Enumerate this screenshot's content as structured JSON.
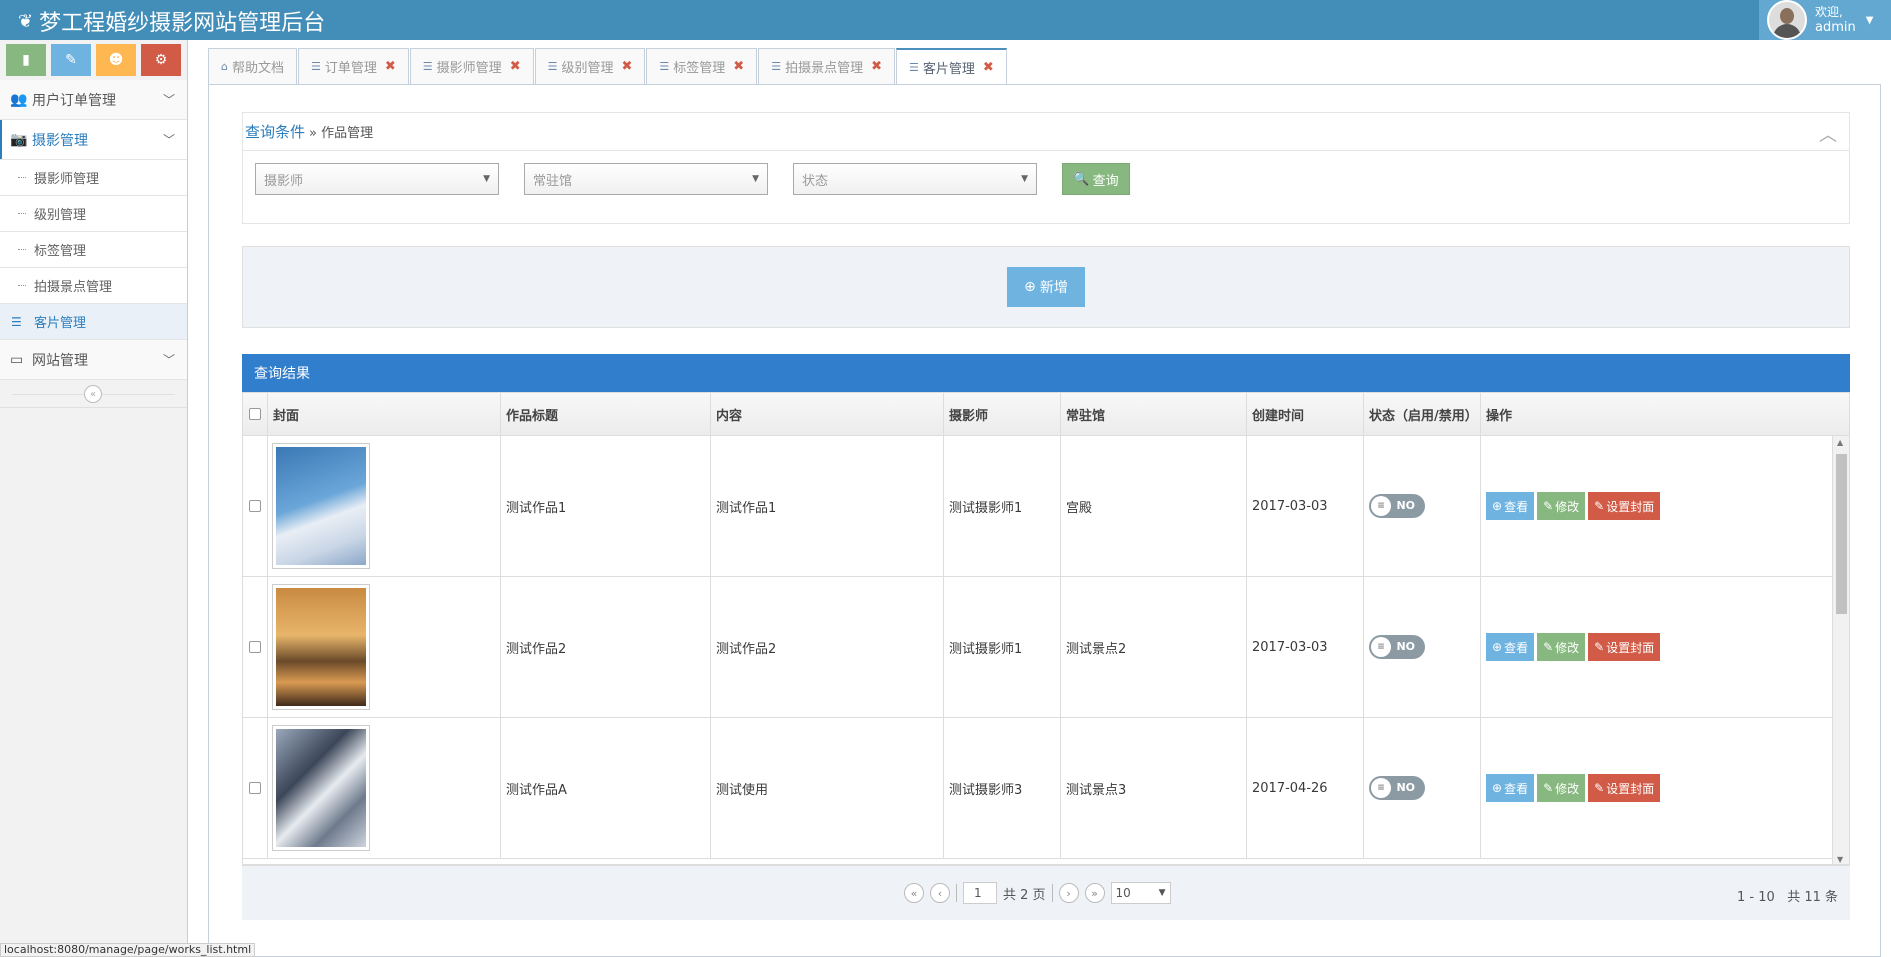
{
  "app": {
    "title": "梦工程婚纱摄影网站管理后台",
    "welcome": "欢迎,",
    "user": "admin"
  },
  "colors": {
    "topbar": "#438eb9",
    "accent": "#307ecc",
    "green": "#87b87f",
    "blue": "#6fb3e0",
    "orange": "#ffb752",
    "red": "#d15b47"
  },
  "sidebar": {
    "shortcuts": [
      {
        "icon": "signal-icon"
      },
      {
        "icon": "pencil-icon"
      },
      {
        "icon": "users-icon"
      },
      {
        "icon": "cogs-icon"
      }
    ],
    "menu": [
      {
        "label": "用户订单管理",
        "icon": "users-icon"
      },
      {
        "label": "摄影管理",
        "icon": "camera-icon"
      },
      {
        "label": "网站管理",
        "icon": "desktop-icon"
      }
    ],
    "submenu": [
      "摄影师管理",
      "级别管理",
      "标签管理",
      "拍摄景点管理",
      "客片管理"
    ]
  },
  "tabs": [
    {
      "label": "帮助文档",
      "closable": false
    },
    {
      "label": "订单管理",
      "closable": true
    },
    {
      "label": "摄影师管理",
      "closable": true
    },
    {
      "label": "级别管理",
      "closable": true
    },
    {
      "label": "标签管理",
      "closable": true
    },
    {
      "label": "拍摄景点管理",
      "closable": true
    },
    {
      "label": "客片管理",
      "closable": true,
      "active": true
    }
  ],
  "query": {
    "title": "查询条件",
    "breadcrumb": "» 作品管理",
    "selects": [
      "摄影师",
      "常驻馆",
      "状态"
    ],
    "search_label": "查询"
  },
  "add_label": "新增",
  "results": {
    "title": "查询结果",
    "columns": [
      "封面",
      "作品标题",
      "内容",
      "摄影师",
      "常驻馆",
      "创建时间",
      "状态（启用/禁用）",
      "操作"
    ],
    "rows": [
      {
        "title": "测试作品1",
        "content": "测试作品1",
        "photographer": "测试摄影师1",
        "venue": "宫殿",
        "created": "2017-03-03",
        "status": "NO"
      },
      {
        "title": "测试作品2",
        "content": "测试作品2",
        "photographer": "测试摄影师1",
        "venue": "测试景点2",
        "created": "2017-03-03",
        "status": "NO"
      },
      {
        "title": "测试作品A",
        "content": "测试使用",
        "photographer": "测试摄影师3",
        "venue": "测试景点3",
        "created": "2017-04-26",
        "status": "NO"
      }
    ],
    "actions": {
      "view": "查看",
      "edit": "修改",
      "cover": "设置封面"
    }
  },
  "pager": {
    "page": "1",
    "total_pages": "共 2 页",
    "page_size": "10",
    "range": "1 - 10",
    "total": "共 11 条"
  },
  "statusbar": "localhost:8080/manage/page/works_list.html"
}
